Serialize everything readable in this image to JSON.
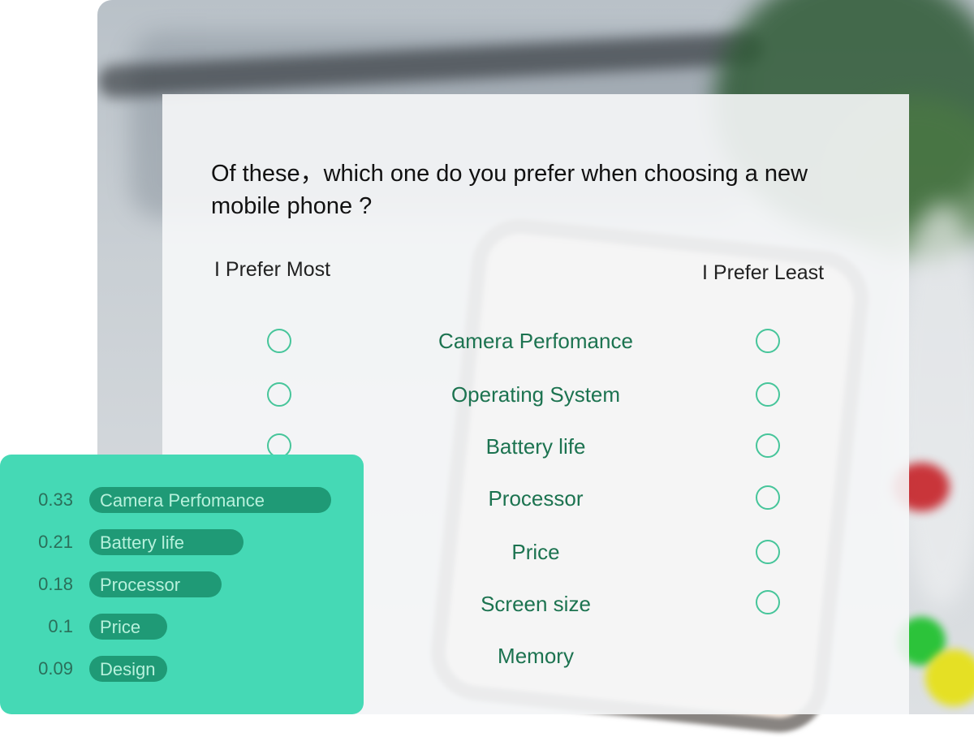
{
  "survey": {
    "question": "Of these，which one do you prefer when choosing a new mobile phone ?",
    "most_label": "I Prefer Most",
    "least_label": "I Prefer Least",
    "options": [
      "Camera Perfomance",
      "Operating System",
      "Battery life",
      "Processor",
      "Price",
      "Screen size",
      "Memory"
    ]
  },
  "results": {
    "items": [
      {
        "value": "0.33",
        "label": "Camera Perfomance",
        "share": 0.33
      },
      {
        "value": "0.21",
        "label": "Battery life",
        "share": 0.21
      },
      {
        "value": "0.18",
        "label": "Processor",
        "share": 0.18
      },
      {
        "value": "0.1",
        "label": "Price",
        "share": 0.1
      },
      {
        "value": "0.09",
        "label": "Design",
        "share": 0.09
      }
    ]
  },
  "colors": {
    "accent": "#46c59a",
    "option_text": "#1c7350",
    "panel": "#45d9b5",
    "bar": "#1f9a76"
  }
}
